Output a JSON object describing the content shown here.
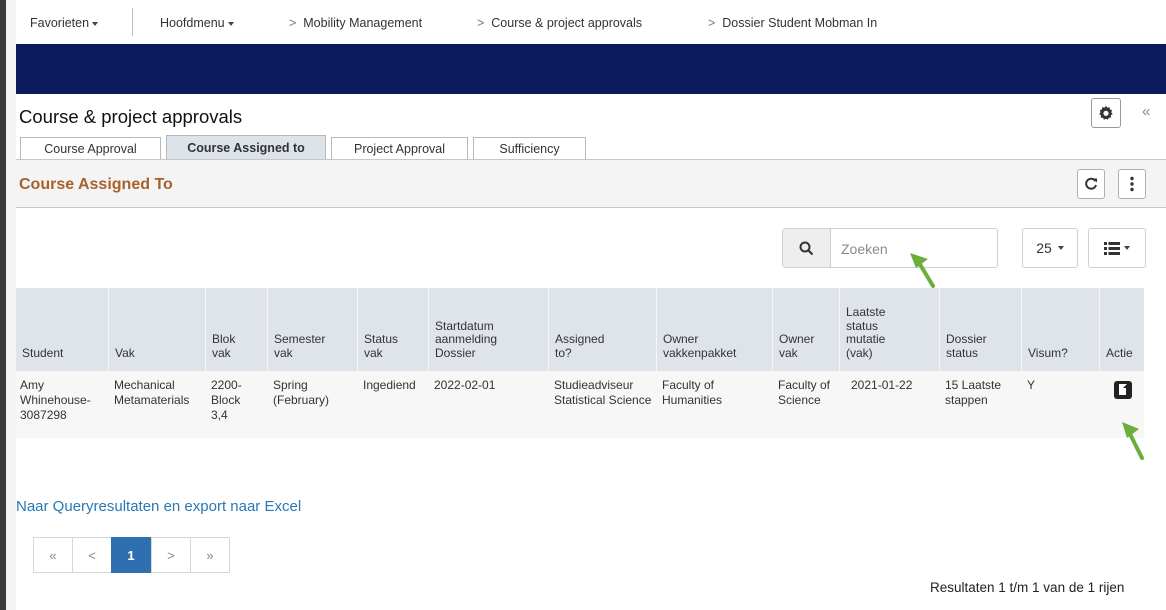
{
  "nav": {
    "favorites": "Favorieten",
    "main_menu": "Hoofdmenu",
    "crumbs": [
      "Mobility Management",
      "Course & project approvals",
      "Dossier Student Mobman In"
    ]
  },
  "page": {
    "title": "Course & project approvals"
  },
  "tabs": [
    {
      "label": "Course Approval",
      "active": false
    },
    {
      "label": "Course Assigned to",
      "active": true
    },
    {
      "label": "Project Approval",
      "active": false
    },
    {
      "label": "Sufficiency",
      "active": false
    }
  ],
  "section": {
    "title": "Course Assigned To"
  },
  "search": {
    "placeholder": "Zoeken"
  },
  "page_size": "25",
  "columns": [
    "Student",
    "Vak",
    "Blok vak",
    "Semester vak",
    "Status vak",
    "Startdatum aanmelding Dossier",
    "Assigned to?",
    "Owner vakkenpakket",
    "Owner vak",
    "Laatste status mutatie (vak)",
    "Dossier status",
    "Visum?",
    "Actie"
  ],
  "rows": [
    {
      "student": "Amy Whinehouse-3087298",
      "vak": "Mechanical Metamaterials",
      "blok": "2200-Block 3,4",
      "semester": "Spring (February)",
      "status": "Ingediend",
      "startdatum": "2022-02-01",
      "assigned": "Studieadviseur Statistical Science",
      "owner_pakket": "Faculty of Humanities",
      "owner_vak": "Faculty of Science",
      "laatste": "2021-01-22",
      "dossier": "15 Laatste stappen",
      "visum": "Y"
    }
  ],
  "export_link": "Naar Queryresultaten en export naar Excel",
  "pagination": {
    "first": "«",
    "prev": "<",
    "current": "1",
    "next": ">",
    "last": "»"
  },
  "results_text": "Resultaten 1 t/m 1 van de 1 rijen",
  "colors": {
    "navy": "#0c1a5e",
    "accent_orange": "#a8612a",
    "link_blue": "#2a78b4",
    "page_active": "#2d6fb0",
    "arrow_green": "#6aae3c"
  }
}
